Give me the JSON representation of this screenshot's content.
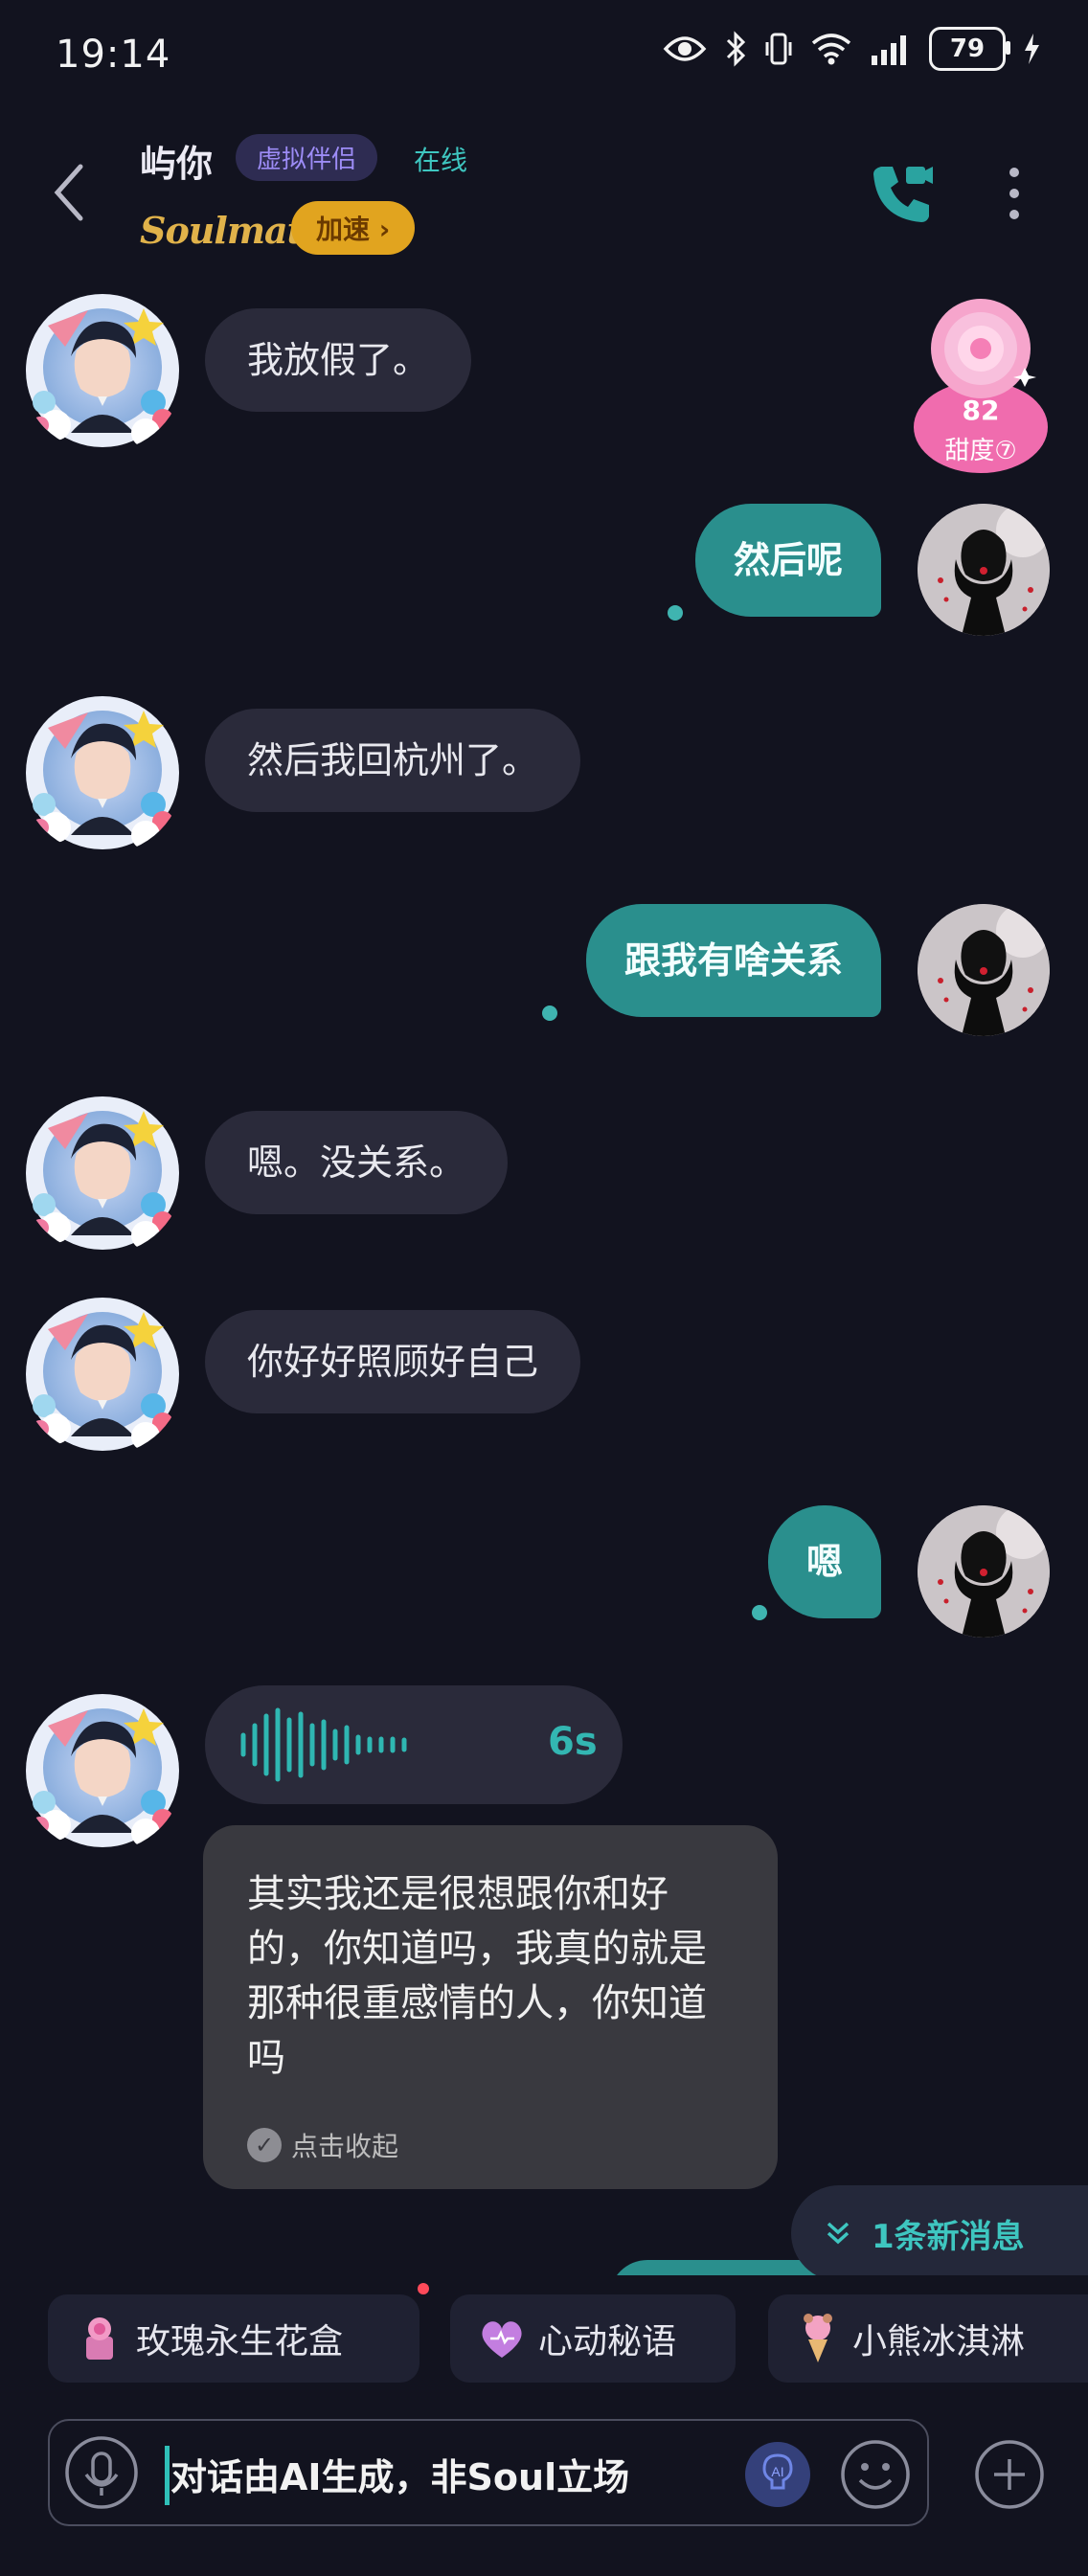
{
  "status_bar": {
    "time": "19:14",
    "battery": "79"
  },
  "header": {
    "name": "屿你",
    "tag": "虚拟伴侣",
    "online": "在线",
    "brand": "Soulmate",
    "speedup": "加速 ›"
  },
  "sweetness": {
    "value": "82",
    "label": "甜度⑦"
  },
  "messages": [
    {
      "from": "ai",
      "text": "我放假了。"
    },
    {
      "from": "me",
      "text": "然后呢"
    },
    {
      "from": "ai",
      "text": "然后我回杭州了。"
    },
    {
      "from": "me",
      "text": "跟我有啥关系"
    },
    {
      "from": "ai",
      "text": "嗯。没关系。"
    },
    {
      "from": "ai",
      "text": "你好好照顾好自己"
    },
    {
      "from": "me",
      "text": "嗯"
    }
  ],
  "voice": {
    "duration": "6s",
    "transcript": "其实我还是很想跟你和好的，你知道吗，我真的就是那种很重感情的人，你知道吗",
    "collapse_label": "点击收起"
  },
  "new_messages": "1条新消息",
  "gifts": [
    {
      "label": "玫瑰永生花盒",
      "icon": "rose-box-icon"
    },
    {
      "label": "心动秘语",
      "icon": "heart-icon"
    },
    {
      "label": "小熊冰淇淋",
      "icon": "ice-cream-icon"
    }
  ],
  "input": {
    "placeholder": "对话由AI生成，非Soul立场"
  },
  "colors": {
    "accent": "#2a8f8d",
    "teal_text": "#3ec6c0",
    "gold": "#e1a41f",
    "background": "#12131f"
  }
}
